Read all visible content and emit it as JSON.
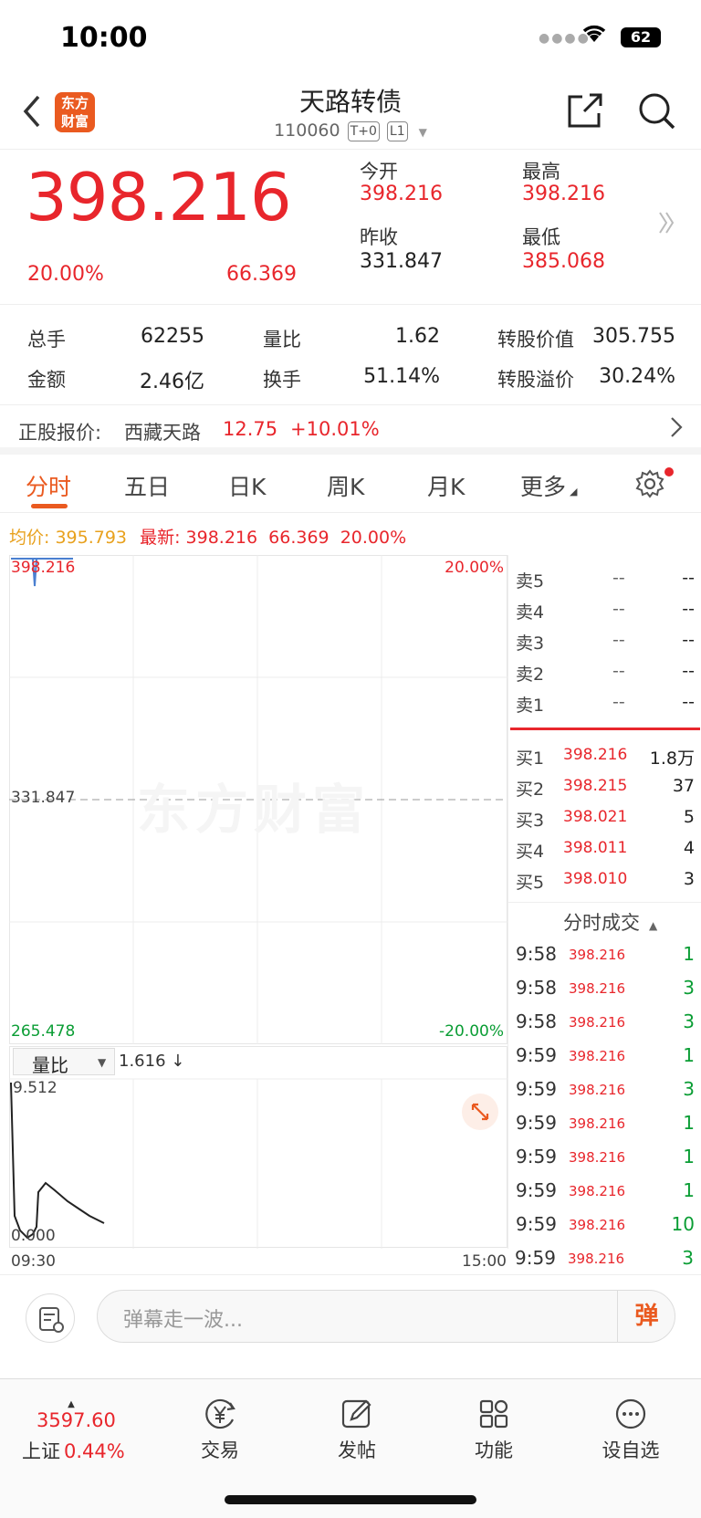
{
  "status": {
    "time": "10:00",
    "battery": "62"
  },
  "header": {
    "logo_line1": "东方",
    "logo_line2": "财富",
    "title": "天路转债",
    "code": "110060",
    "tag1": "T+0",
    "tag2": "L1"
  },
  "price": {
    "last": "398.216",
    "pct": "20.00%",
    "change": "66.369",
    "open_label": "今开",
    "open": "398.216",
    "high_label": "最高",
    "high": "398.216",
    "prev_label": "昨收",
    "prev": "331.847",
    "low_label": "最低",
    "low": "385.068"
  },
  "stats": {
    "vol_label": "总手",
    "vol": "62255",
    "ratio_label": "量比",
    "ratio": "1.62",
    "conv_value_label": "转股价值",
    "conv_value": "305.755",
    "amount_label": "金额",
    "amount": "2.46亿",
    "turnover_label": "换手",
    "turnover": "51.14%",
    "premium_label": "转股溢价",
    "premium": "30.24%"
  },
  "stock": {
    "label": "正股报价:",
    "name": "西藏天路",
    "price": "12.75",
    "change": "+10.01%"
  },
  "tabs": [
    "分时",
    "五日",
    "日K",
    "周K",
    "月K",
    "更多"
  ],
  "avg": {
    "avg_label": "均价:",
    "avg": "395.793",
    "latest_label": "最新:",
    "latest": "398.216",
    "change": "66.369",
    "pct": "20.00%"
  },
  "chart": {
    "top_price": "398.216",
    "top_pct": "20.00%",
    "mid_price": "331.847",
    "bottom_price": "265.478",
    "bottom_pct": "-20.00%",
    "watermark": "东方财富",
    "vol_selector": "量比",
    "vol_value": "1.616 ↓",
    "vol_max": "9.512",
    "vol_min": "0.000",
    "time_start": "09:30",
    "time_end": "15:00"
  },
  "book": {
    "asks": [
      {
        "name": "卖5",
        "price": "--",
        "qty": "--"
      },
      {
        "name": "卖4",
        "price": "--",
        "qty": "--"
      },
      {
        "name": "卖3",
        "price": "--",
        "qty": "--"
      },
      {
        "name": "卖2",
        "price": "--",
        "qty": "--"
      },
      {
        "name": "卖1",
        "price": "--",
        "qty": "--"
      }
    ],
    "bids": [
      {
        "name": "买1",
        "price": "398.216",
        "qty": "1.8万"
      },
      {
        "name": "买2",
        "price": "398.215",
        "qty": "37"
      },
      {
        "name": "买3",
        "price": "398.021",
        "qty": "5"
      },
      {
        "name": "买4",
        "price": "398.011",
        "qty": "4"
      },
      {
        "name": "买5",
        "price": "398.010",
        "qty": "3"
      }
    ]
  },
  "ticks": {
    "header": "分时成交",
    "rows": [
      {
        "time": "9:58",
        "price": "398.216",
        "vol": "1"
      },
      {
        "time": "9:58",
        "price": "398.216",
        "vol": "3"
      },
      {
        "time": "9:58",
        "price": "398.216",
        "vol": "3"
      },
      {
        "time": "9:59",
        "price": "398.216",
        "vol": "1"
      },
      {
        "time": "9:59",
        "price": "398.216",
        "vol": "3"
      },
      {
        "time": "9:59",
        "price": "398.216",
        "vol": "1"
      },
      {
        "time": "9:59",
        "price": "398.216",
        "vol": "1"
      },
      {
        "time": "9:59",
        "price": "398.216",
        "vol": "1"
      },
      {
        "time": "9:59",
        "price": "398.216",
        "vol": "10"
      },
      {
        "time": "9:59",
        "price": "398.216",
        "vol": "3"
      }
    ]
  },
  "comment": {
    "placeholder": "弹幕走一波...",
    "danmu": "弹"
  },
  "bottom": {
    "index_value": "3597.60",
    "index_name": "上证",
    "index_pct": "0.44%",
    "items": [
      "交易",
      "发帖",
      "功能",
      "设自选"
    ]
  }
}
